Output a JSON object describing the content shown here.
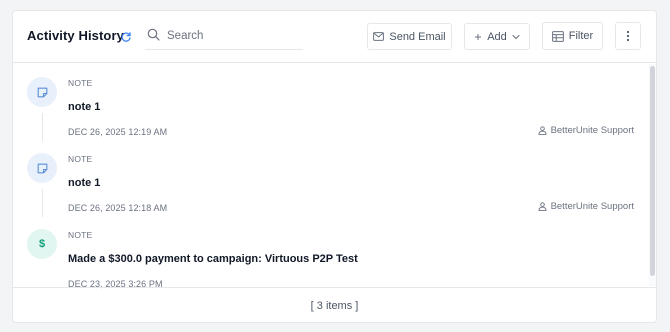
{
  "header": {
    "title": "Activity History",
    "search_placeholder": "Search",
    "send_email_label": "Send Email",
    "add_label": "Add",
    "filter_label": "Filter"
  },
  "activities": [
    {
      "type": "NOTE",
      "text": "note 1",
      "date": "DEC 26, 2025 12:19 AM",
      "author": "BetterUnite Support",
      "icon": "note-icon"
    },
    {
      "type": "NOTE",
      "text": "note 1",
      "date": "DEC 26, 2025 12:18 AM",
      "author": "BetterUnite Support",
      "icon": "note-icon"
    },
    {
      "type": "NOTE",
      "text": "Made a $300.0 payment to campaign: Virtuous P2P Test",
      "date": "DEC 23, 2025 3:26 PM",
      "icon": "dollar-icon",
      "icon_glyph": "$"
    }
  ],
  "footer": {
    "count_label": "[ 3 items ]"
  },
  "colors": {
    "note_icon_bg": "#e8f0fb",
    "note_icon_fg": "#5b8fd6",
    "money_icon_bg": "#e2f6f1",
    "money_icon_fg": "#0f9f7a",
    "refresh_icon": "#3b82f6"
  }
}
